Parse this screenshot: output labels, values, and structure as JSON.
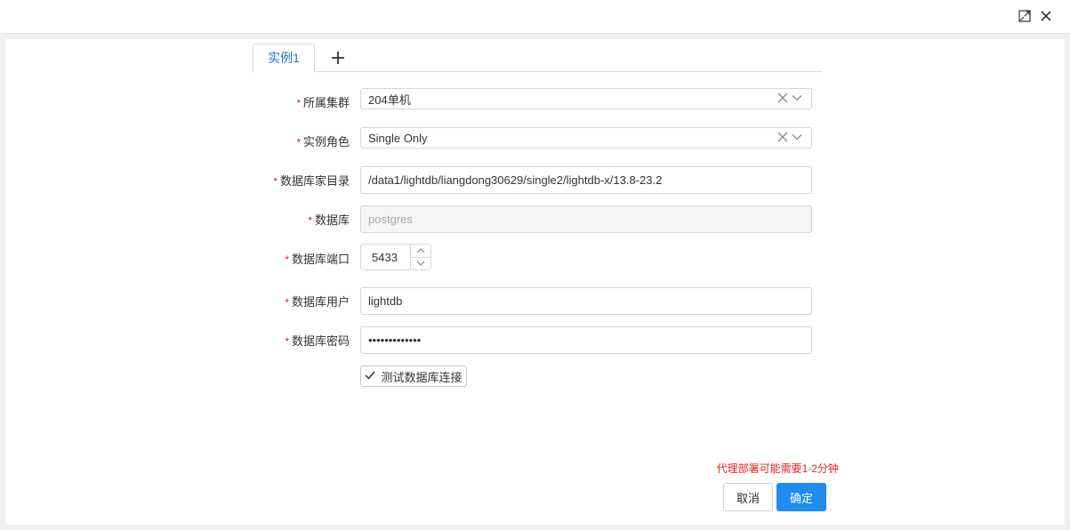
{
  "window": {
    "maximize_icon": "expand-icon",
    "close_icon": "close-icon"
  },
  "tabs": [
    {
      "label": "实例1",
      "active": true
    }
  ],
  "add_tab_icon": "plus-icon",
  "form": {
    "cluster": {
      "label": "所属集群",
      "value": "204单机"
    },
    "role": {
      "label": "实例角色",
      "value": "Single Only"
    },
    "home_dir": {
      "label": "数据库家目录",
      "value": "/data1/lightdb/liangdong30629/single2/lightdb-x/13.8-23.2"
    },
    "database": {
      "label": "数据库",
      "value": "postgres"
    },
    "port": {
      "label": "数据库端口",
      "value": "5433"
    },
    "user": {
      "label": "数据库用户",
      "value": "lightdb"
    },
    "password": {
      "label": "数据库密码",
      "value": "•••••••••••••"
    }
  },
  "test_button": {
    "label": "测试数据库连接",
    "icon": "check-icon"
  },
  "notice": "代理部署可能需要1-2分钟",
  "footer": {
    "cancel_label": "取消",
    "ok_label": "确定"
  },
  "colors": {
    "accent": "#1e8cf0",
    "required": "#e1251b",
    "tab_text": "#1f78d1"
  }
}
